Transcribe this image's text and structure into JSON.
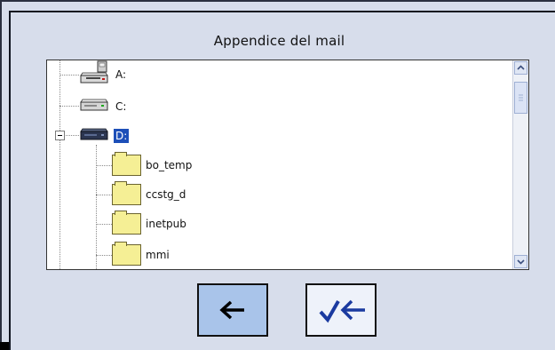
{
  "dialog": {
    "title": "Appendice del mail"
  },
  "tree": {
    "items": [
      {
        "label": "A:",
        "type": "floppy-drive",
        "selected": false
      },
      {
        "label": "C:",
        "type": "hard-drive",
        "selected": false
      },
      {
        "label": "D:",
        "type": "hard-drive",
        "selected": true,
        "expanded": true
      },
      {
        "label": "bo_temp",
        "type": "folder"
      },
      {
        "label": "ccstg_d",
        "type": "folder"
      },
      {
        "label": "inetpub",
        "type": "folder"
      },
      {
        "label": "mmi",
        "type": "folder"
      }
    ]
  },
  "scrollbar": {
    "up_icon": "chevron-up",
    "down_icon": "chevron-down"
  },
  "buttons": {
    "back_icon": "arrow-left-icon",
    "confirm_icon": "check-arrow-left-icon"
  },
  "colors": {
    "background": "#d7ddeb",
    "selection": "#1d4fb8",
    "back_button": "#a9c4ea",
    "confirm_button": "#eef2fa",
    "folder": "#f5ef95"
  }
}
